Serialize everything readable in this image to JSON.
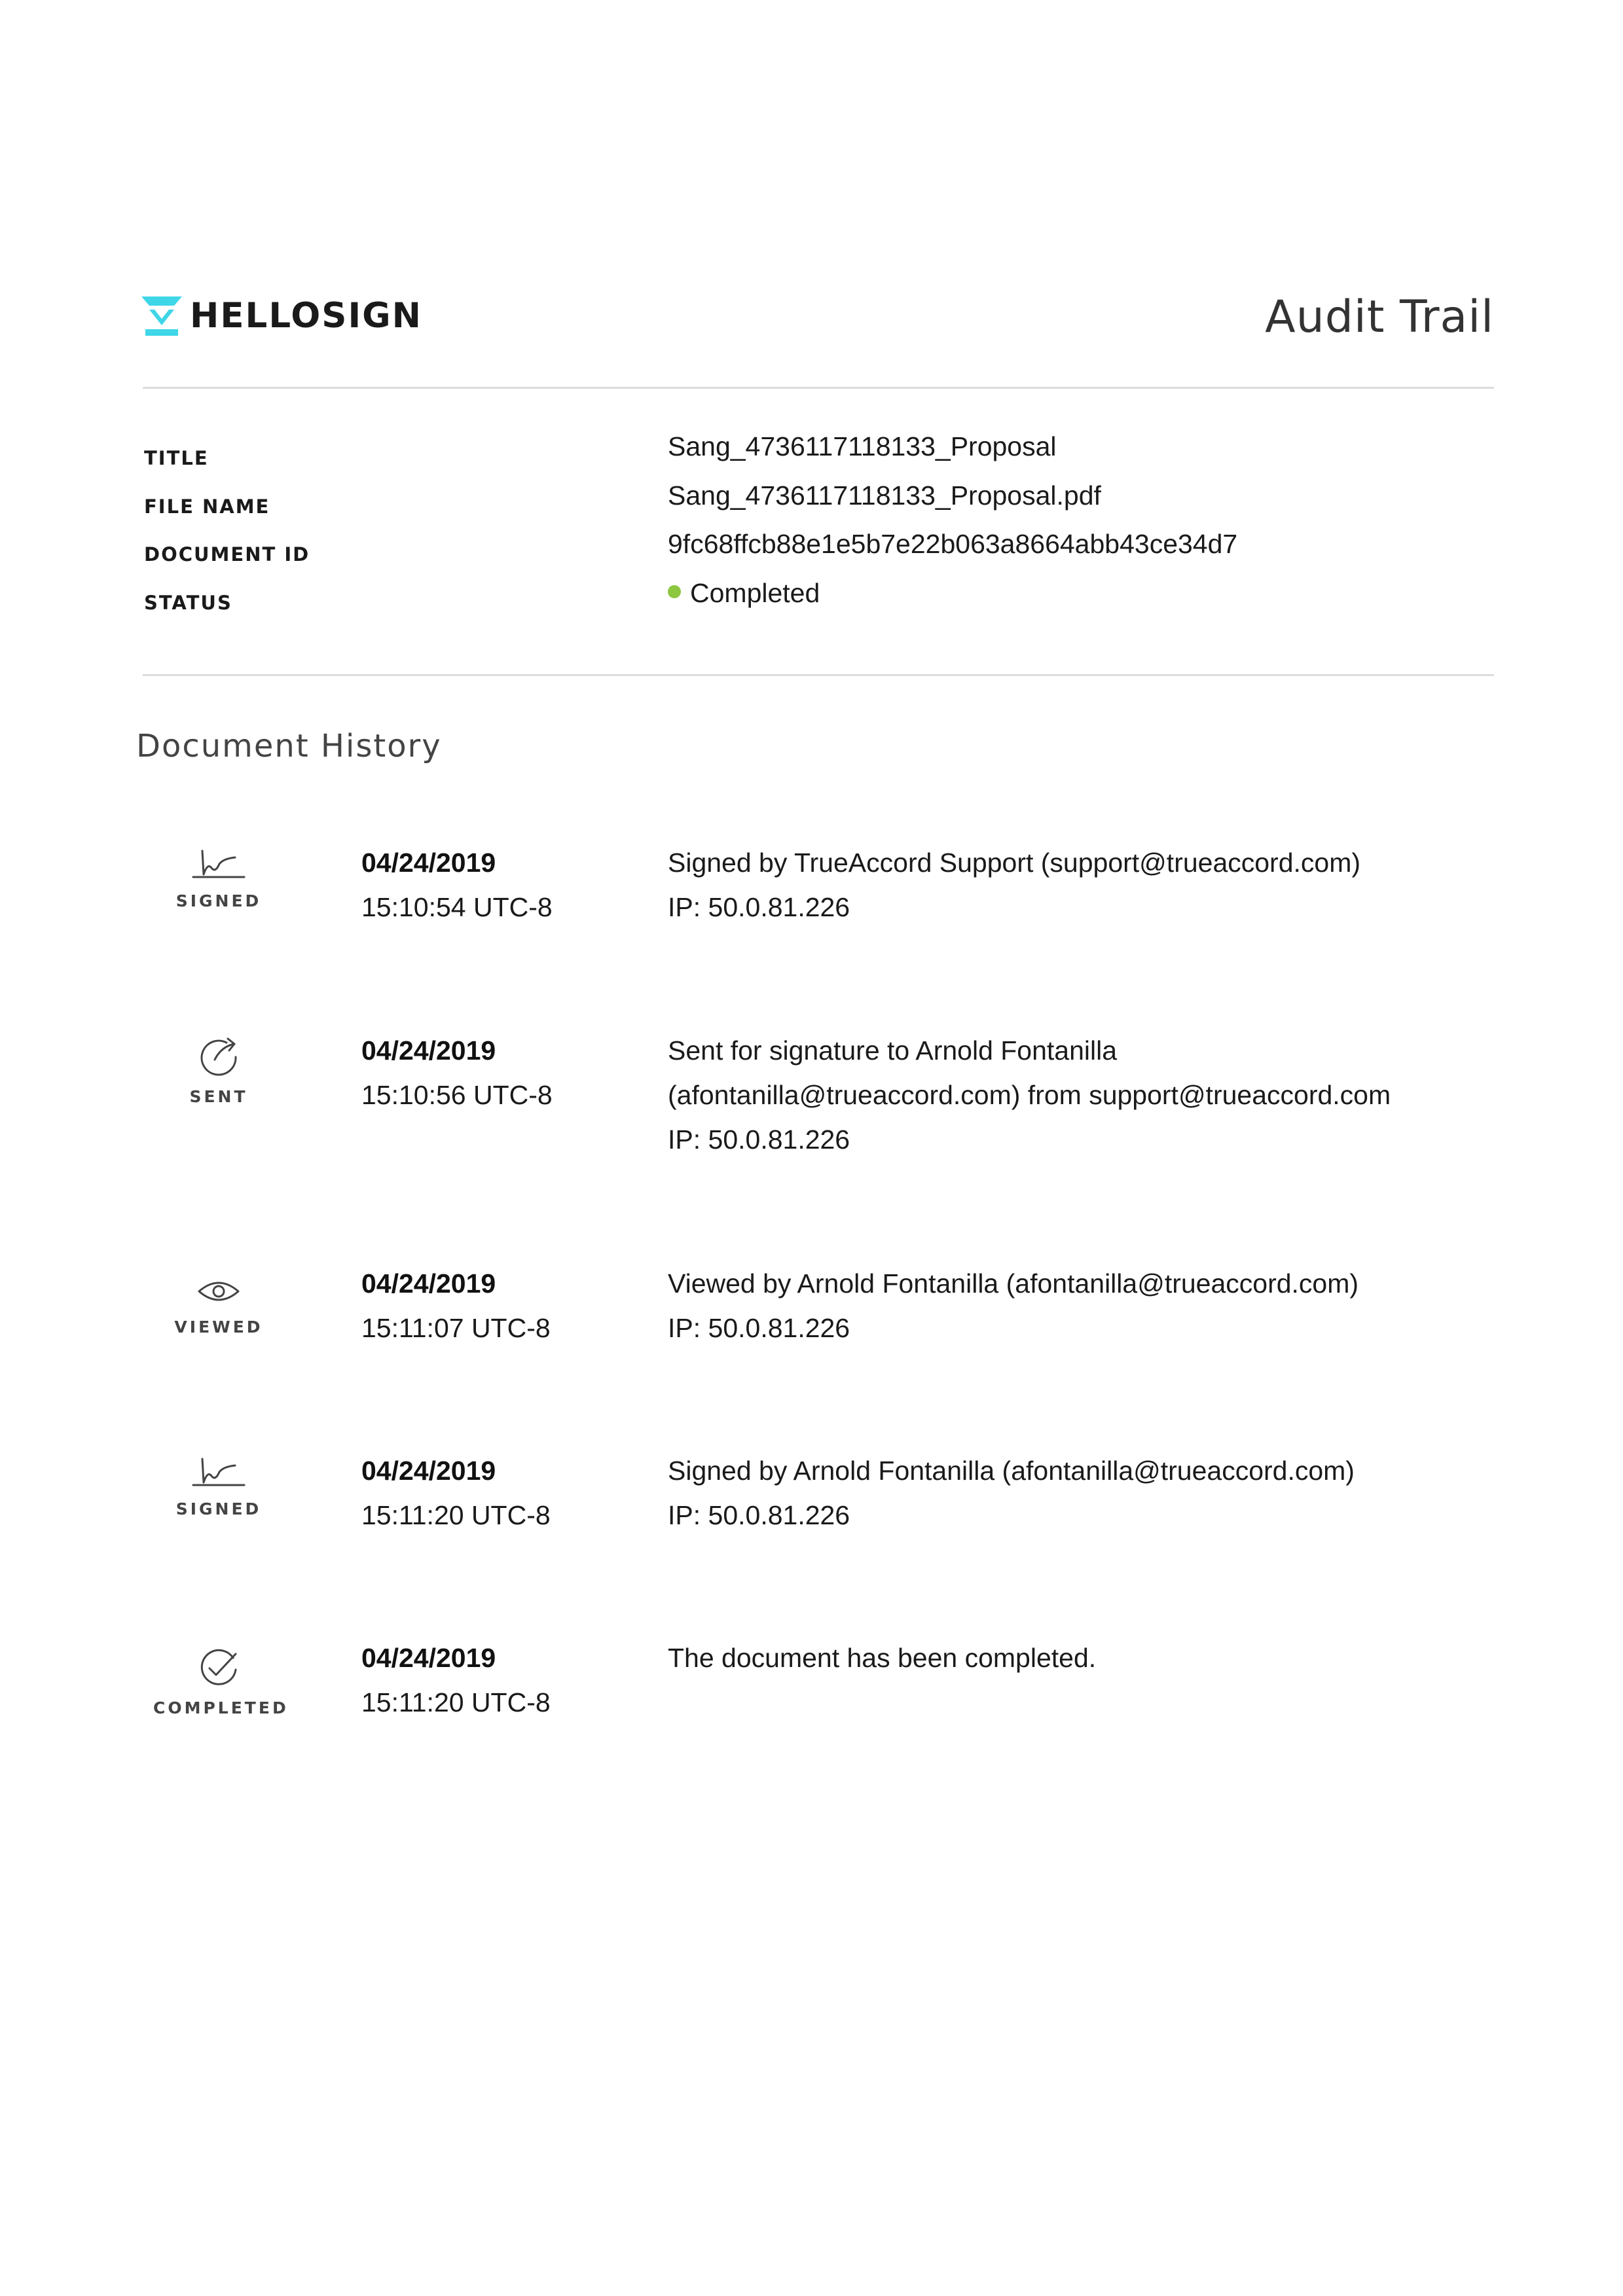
{
  "header": {
    "logo_text": "HELLOSIGN",
    "title": "Audit Trail",
    "brand_color": "#3fd6e8"
  },
  "metadata": {
    "title_label": "TITLE",
    "title_value": "Sang_4736117118133_Proposal",
    "file_name_label": "FILE NAME",
    "file_name_value": "Sang_4736117118133_Proposal.pdf",
    "document_id_label": "DOCUMENT ID",
    "document_id_value": "9fc68ffcb88e1e5b7e22b063a8664abb43ce34d7",
    "status_label": "STATUS",
    "status_value": "Completed",
    "status_color": "#8dc63f"
  },
  "history": {
    "section_title": "Document History",
    "events": [
      {
        "icon": "signature-icon",
        "label": "SIGNED",
        "date": "04/24/2019",
        "time": "15:10:54 UTC-8",
        "lines": [
          "Signed by TrueAccord Support (support@trueaccord.com)",
          "IP: 50.0.81.226"
        ]
      },
      {
        "icon": "sent-arrow-icon",
        "label": "SENT",
        "date": "04/24/2019",
        "time": "15:10:56 UTC-8",
        "lines": [
          "Sent for signature to Arnold Fontanilla",
          "(afontanilla@trueaccord.com) from support@trueaccord.com",
          "IP: 50.0.81.226"
        ]
      },
      {
        "icon": "eye-icon",
        "label": "VIEWED",
        "date": "04/24/2019",
        "time": "15:11:07 UTC-8",
        "lines": [
          "Viewed by Arnold Fontanilla (afontanilla@trueaccord.com)",
          "IP: 50.0.81.226"
        ]
      },
      {
        "icon": "signature-icon",
        "label": "SIGNED",
        "date": "04/24/2019",
        "time": "15:11:20 UTC-8",
        "lines": [
          "Signed by Arnold Fontanilla (afontanilla@trueaccord.com)",
          "IP: 50.0.81.226"
        ]
      },
      {
        "icon": "check-circle-icon",
        "label": "COMPLETED",
        "date": "04/24/2019",
        "time": "15:11:20 UTC-8",
        "lines": [
          "The document has been completed."
        ]
      }
    ]
  }
}
